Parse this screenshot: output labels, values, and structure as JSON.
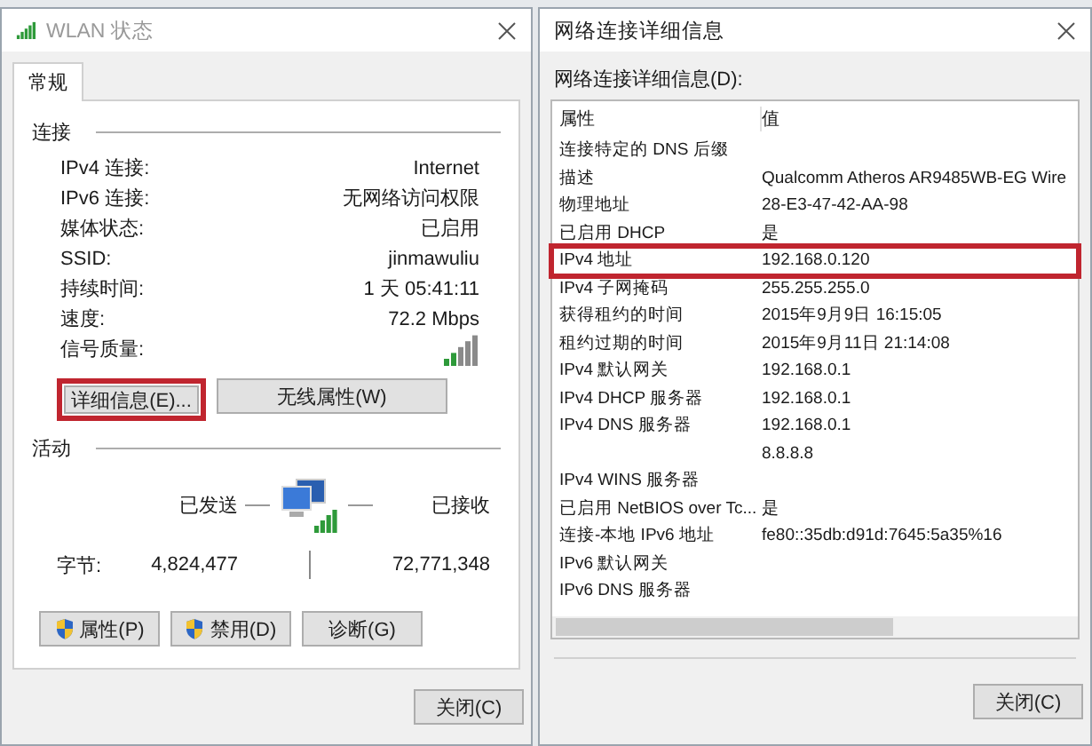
{
  "status_window": {
    "title": "WLAN 状态",
    "tabs": [
      {
        "label": "常规",
        "selected": true
      }
    ],
    "connection": {
      "heading": "连接",
      "rows": [
        {
          "kind": "text",
          "label": "IPv4 连接:",
          "value": "Internet"
        },
        {
          "kind": "text",
          "label": "IPv6 连接:",
          "value": "无网络访问权限"
        },
        {
          "kind": "text",
          "label": "媒体状态:",
          "value": "已启用"
        },
        {
          "kind": "text",
          "label": "SSID:",
          "value": "jinmawuliu"
        },
        {
          "kind": "text",
          "label": "持续时间:",
          "value": "1 天 05:41:11"
        },
        {
          "kind": "text",
          "label": "速度:",
          "value": "72.2 Mbps"
        },
        {
          "kind": "signal",
          "label": "信号质量:"
        }
      ]
    },
    "buttons": [
      {
        "label": "详细信息(E)...",
        "highlighted": true
      },
      {
        "label": "无线属性(W)",
        "highlighted": false
      }
    ],
    "activity": {
      "heading": "活动",
      "sent_label": "已发送",
      "received_label": "已接收",
      "bytes_label": "字节:",
      "bytes_sent": "4,824,477",
      "bytes_received": "72,771,348"
    },
    "action_buttons": [
      {
        "label": "属性(P)",
        "shield": true
      },
      {
        "label": "禁用(D)",
        "shield": true
      },
      {
        "label": "诊断(G)",
        "shield": false
      }
    ],
    "close_button": "关闭(C)"
  },
  "details_window": {
    "title": "网络连接详细信息",
    "list_label": "网络连接详细信息(D):",
    "columns": [
      "属性",
      "值"
    ],
    "rows": [
      {
        "property": "连接特定的 DNS 后缀",
        "highlighted": false
      },
      {
        "property": "描述",
        "value": "Qualcomm Atheros AR9485WB-EG Wire",
        "highlighted": false
      },
      {
        "property": "物理地址",
        "value": "28-E3-47-42-AA-98",
        "highlighted": false
      },
      {
        "property": "已启用 DHCP",
        "value": "是",
        "highlighted": false
      },
      {
        "property": "IPv4 地址",
        "value": "192.168.0.120",
        "highlighted": true
      },
      {
        "property": "IPv4 子网掩码",
        "value": "255.255.255.0",
        "highlighted": false
      },
      {
        "property": "获得租约的时间",
        "value": "2015年9月9日 16:15:05",
        "highlighted": false
      },
      {
        "property": "租约过期的时间",
        "value": "2015年9月11日 21:14:08",
        "highlighted": false
      },
      {
        "property": "IPv4 默认网关",
        "value": "192.168.0.1",
        "highlighted": false
      },
      {
        "property": "IPv4 DHCP 服务器",
        "value": "192.168.0.1",
        "highlighted": false
      },
      {
        "property": "IPv4 DNS 服务器",
        "value": "192.168.0.1",
        "highlighted": false
      },
      {
        "value": "8.8.8.8",
        "highlighted": false
      },
      {
        "property": "IPv4 WINS 服务器",
        "highlighted": false
      },
      {
        "property": "已启用 NetBIOS over Tc...",
        "value": "是",
        "highlighted": false
      },
      {
        "property": "连接-本地 IPv6 地址",
        "value": "fe80::35db:d91d:7645:5a35%16",
        "highlighted": false
      },
      {
        "property": "IPv6 默认网关",
        "highlighted": false
      },
      {
        "property": "IPv6 DNS 服务器",
        "highlighted": false
      }
    ],
    "close_button": "关闭(C)"
  }
}
